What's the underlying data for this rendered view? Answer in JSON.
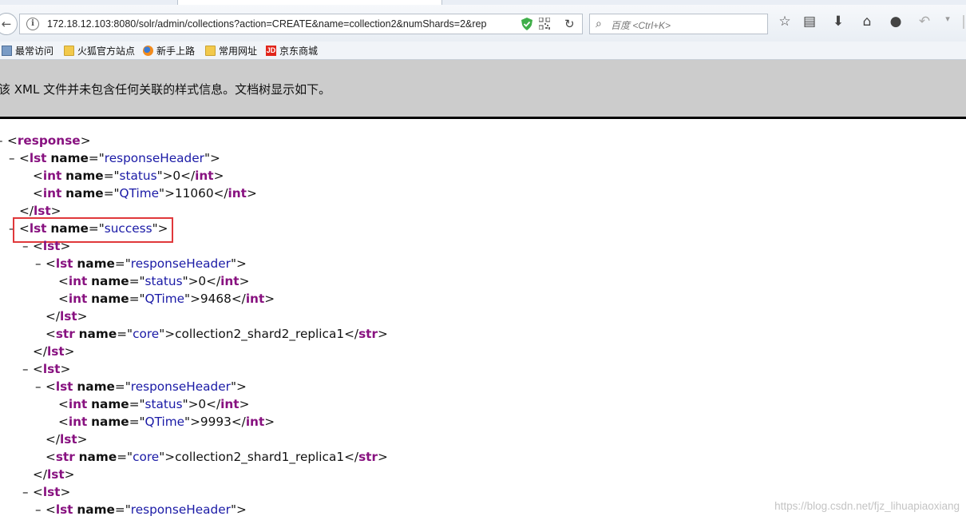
{
  "browser": {
    "url": "172.18.12.103:8080/solr/admin/collections?action=CREATE&name=collection2&numShards=2&rep",
    "search_placeholder": "百度 <Ctrl+K>"
  },
  "bookmarks": [
    "最常访问",
    "火狐官方站点",
    "新手上路",
    "常用网址",
    "京东商城"
  ],
  "notice": "该 XML 文件并未包含任何关联的样式信息。文档树显示如下。",
  "xml": {
    "response_tag": "response",
    "lst_tag": "lst",
    "int_tag": "int",
    "str_tag": "str",
    "name_attr": "name",
    "response_header": "responseHeader",
    "status": "status",
    "qtime": "QTime",
    "core": "core",
    "success": "success",
    "header_status_value": "0",
    "header_qtime_value": "11060",
    "shard2_status_value": "0",
    "shard2_qtime_value": "9468",
    "shard2_core_value": "collection2_shard2_replica1",
    "shard1_status_value": "0",
    "shard1_qtime_value": "9993",
    "shard1_core_value": "collection2_shard1_replica1"
  },
  "watermark": "https://blog.csdn.net/fjz_lihuapiaoxiang",
  "colors": {
    "tag": "#881280",
    "attr_value": "#1a1aa6",
    "highlight": "#e0383b",
    "notice_bg": "#cccccc"
  }
}
